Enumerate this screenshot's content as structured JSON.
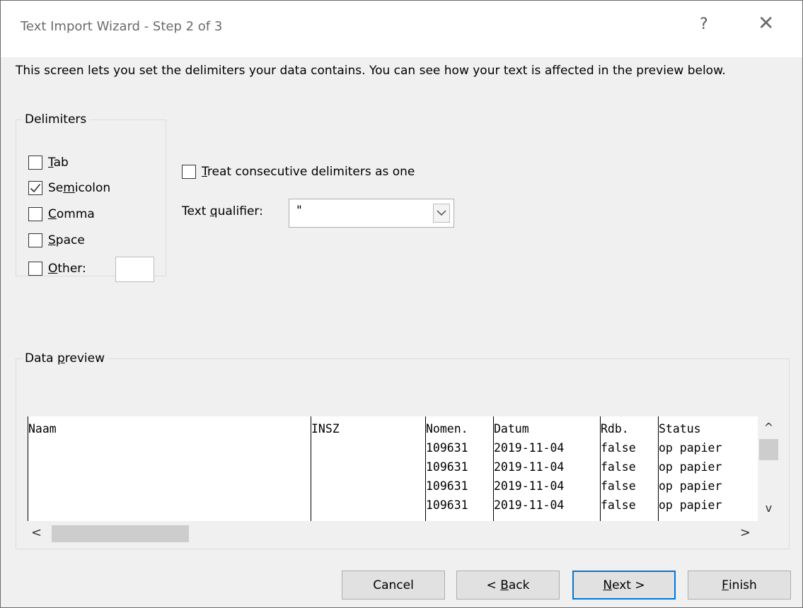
{
  "dialog": {
    "title": "Text Import Wizard - Step 2 of 3",
    "help_symbol": "?",
    "close_symbol": "✕"
  },
  "description": "This screen lets you set the delimiters your data contains.  You can see how your text is affected in the preview below.",
  "delimiters": {
    "legend": "Delimiters",
    "items": [
      {
        "pre": "",
        "key": "T",
        "post": "ab",
        "checked": false
      },
      {
        "pre": "Se",
        "key": "m",
        "post": "icolon",
        "checked": true
      },
      {
        "pre": "",
        "key": "C",
        "post": "omma",
        "checked": false
      },
      {
        "pre": "",
        "key": "S",
        "post": "pace",
        "checked": false
      },
      {
        "pre": "",
        "key": "O",
        "post": "ther:",
        "checked": false
      }
    ],
    "other_value": ""
  },
  "consecutive": {
    "pre": "",
    "key": "T",
    "post": "reat consecutive delimiters as one",
    "checked": false
  },
  "qualifier": {
    "pre": "Text ",
    "key": "q",
    "post": "ualifier:",
    "value": "\""
  },
  "preview": {
    "legend_pre": "Data ",
    "legend_key": "p",
    "legend_post": "review",
    "columns": [
      {
        "lines": [
          "Naam"
        ]
      },
      {
        "lines": [
          "INSZ"
        ]
      },
      {
        "lines": [
          "Nomen.",
          "109631",
          "109631",
          "109631",
          "109631"
        ]
      },
      {
        "lines": [
          "Datum",
          "2019-11-04",
          "2019-11-04",
          "2019-11-04",
          "2019-11-04"
        ]
      },
      {
        "lines": [
          "Rdb.",
          "false",
          "false",
          "false",
          "false"
        ]
      },
      {
        "lines": [
          "Status",
          "op papier",
          "op papier",
          "op papier",
          "op papier"
        ]
      }
    ]
  },
  "scroll": {
    "up": "^",
    "down": "v",
    "left": "<",
    "right": ">"
  },
  "buttons": {
    "cancel": {
      "pre": "Cancel",
      "key": "",
      "post": ""
    },
    "back": {
      "pre": "< ",
      "key": "B",
      "post": "ack"
    },
    "next": {
      "pre": "",
      "key": "N",
      "post": "ext >"
    },
    "finish": {
      "pre": "",
      "key": "F",
      "post": "inish"
    }
  }
}
